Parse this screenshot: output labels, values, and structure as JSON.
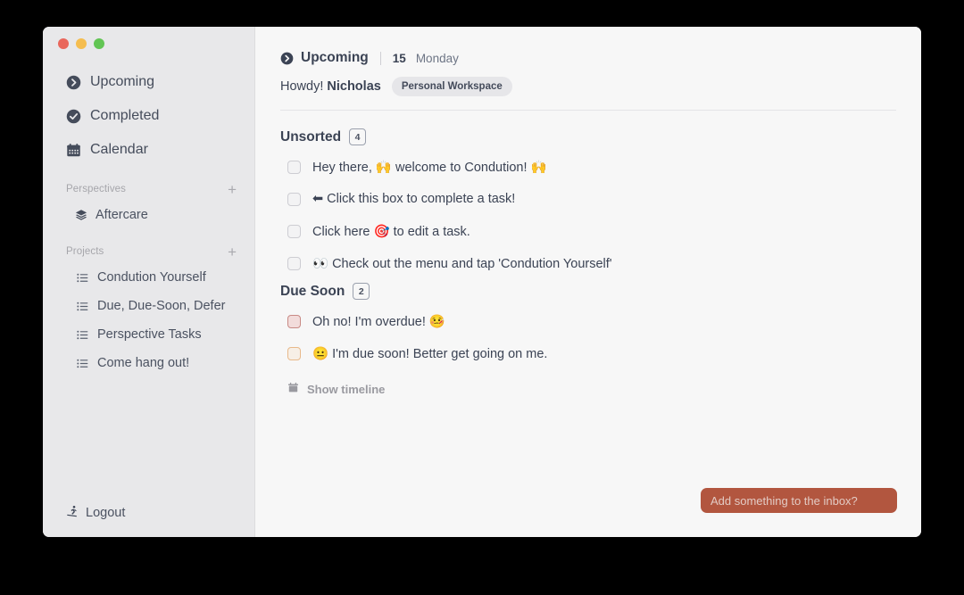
{
  "window": {
    "traffic_lights": [
      {
        "name": "close",
        "color": "#e9675c"
      },
      {
        "name": "minimize",
        "color": "#f5bd4f"
      },
      {
        "name": "zoom",
        "color": "#62c554"
      }
    ]
  },
  "sidebar": {
    "nav": [
      {
        "label": "Upcoming",
        "icon": "chevron-right-circle-icon"
      },
      {
        "label": "Completed",
        "icon": "check-circle-icon"
      },
      {
        "label": "Calendar",
        "icon": "calendar-icon"
      }
    ],
    "perspectives": {
      "title": "Perspectives",
      "add_label": "+",
      "items": [
        {
          "label": "Aftercare",
          "icon": "layers-icon"
        }
      ]
    },
    "projects": {
      "title": "Projects",
      "add_label": "+",
      "items": [
        {
          "label": "Condution Yourself",
          "icon": "list-icon"
        },
        {
          "label": "Due, Due-Soon, Defer",
          "icon": "list-icon"
        },
        {
          "label": "Perspective Tasks",
          "icon": "list-icon"
        },
        {
          "label": "Come hang out!",
          "icon": "list-icon"
        }
      ]
    },
    "logout": {
      "label": "Logout",
      "icon": "skier-icon"
    }
  },
  "header": {
    "breadcrumb_icon": "chevron-right-circle-icon",
    "breadcrumb_title": "Upcoming",
    "date_number": "15",
    "date_day": "Monday",
    "greeting_prefix": "Howdy!",
    "user_name": "Nicholas",
    "workspace_badge": "Personal Workspace"
  },
  "groups": [
    {
      "title": "Unsorted",
      "count": "4",
      "tasks": [
        {
          "text": "Hey there, 🙌 welcome to Condution! 🙌",
          "state": "normal"
        },
        {
          "text": "⬅ Click this box to complete a task!",
          "state": "normal"
        },
        {
          "text": "Click here 🎯 to edit a task.",
          "state": "normal"
        },
        {
          "text": "👀 Check out the menu and tap 'Condution Yourself'",
          "state": "normal"
        }
      ]
    },
    {
      "title": "Due Soon",
      "count": "2",
      "tasks": [
        {
          "text": "Oh no! I'm overdue! 🤒",
          "state": "overdue"
        },
        {
          "text": "😐 I'm due soon! Better get going on me.",
          "state": "duesoon"
        }
      ]
    }
  ],
  "show_timeline": {
    "label": "Show timeline",
    "icon": "calendar-icon"
  },
  "inbox": {
    "placeholder": "Add something to the inbox?",
    "accent": "#b2563f"
  }
}
